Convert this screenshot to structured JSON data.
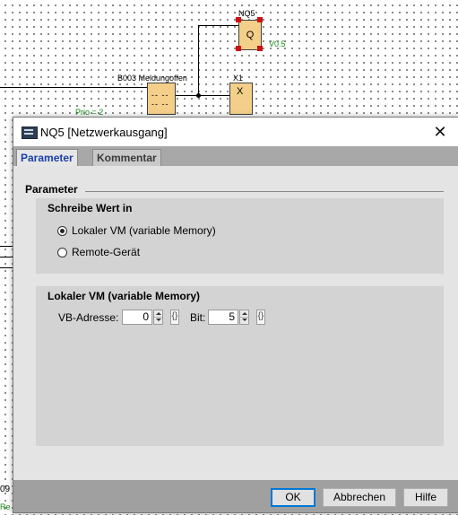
{
  "diagram": {
    "block_nq5_label": "NQ5",
    "block_nq5_symbol": "Q",
    "block_nq5_output": "V0.5",
    "block_b003_label": "B003 Meldungoffen",
    "block_x1_label": "X1",
    "block_x1_symbol": "X",
    "prio_label": "Prio = 2",
    "partial_left_label_1": "09",
    "partial_left_label_2": "Re"
  },
  "dialog": {
    "title": "NQ5 [Netzwerkausgang]",
    "close_glyph": "✕",
    "tabs": [
      {
        "label": "Parameter",
        "active": true
      },
      {
        "label": "Kommentar",
        "active": false
      }
    ],
    "section_title": "Parameter",
    "write_group": {
      "title": "Schreibe Wert in",
      "options": [
        {
          "label": "Lokaler VM (variable Memory)",
          "checked": true
        },
        {
          "label": "Remote-Gerät",
          "checked": false
        }
      ]
    },
    "local_group": {
      "title": "Lokaler VM (variable Memory)",
      "vb_label": "VB-Adresse:",
      "vb_value": "0",
      "bit_label": "Bit:",
      "bit_value": "5",
      "bracket_glyph": "{}"
    },
    "buttons": {
      "ok": "OK",
      "cancel": "Abbrechen",
      "help": "Hilfe"
    }
  },
  "colors": {
    "block_fill": "#f3cf8a",
    "handle": "#d01010",
    "active_tab_text": "#1a3fae",
    "green_text": "#1a8a1a"
  }
}
